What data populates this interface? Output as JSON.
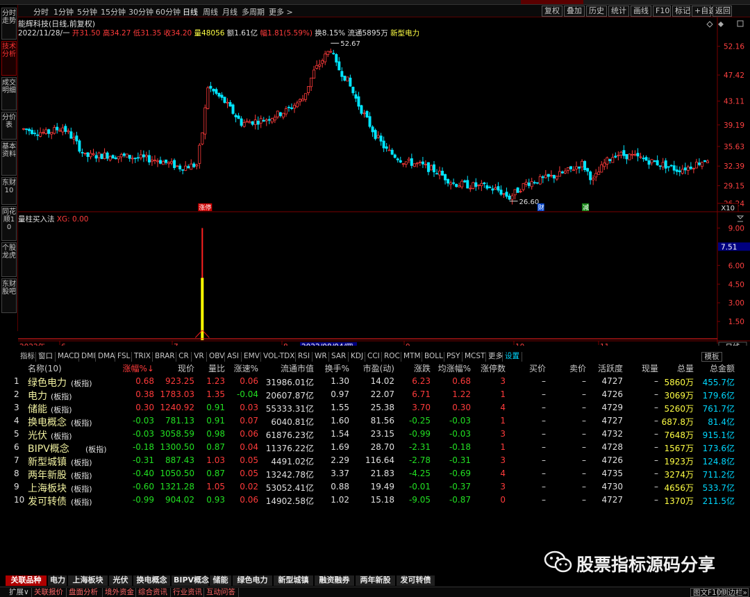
{
  "left_tabs": [
    "分时走势",
    "技术分析",
    "成交明细",
    "分价表",
    "基本资料",
    "东财10",
    "同花顺10",
    "个股龙虎",
    "东财股吧"
  ],
  "periods": [
    "分时",
    "1分钟",
    "5分钟",
    "15分钟",
    "30分钟",
    "60分钟",
    "日线",
    "周线",
    "月线",
    "多周期",
    "更多 >"
  ],
  "active_period": "日线",
  "right_buttons": [
    "复权",
    "叠加",
    "历史",
    "统计",
    "画线",
    "F10",
    "标记",
    "+自选",
    "返回"
  ],
  "stock": {
    "name_line": "能辉科技(日线,前复权)",
    "info_date": "2022/11/28/一",
    "open": "开31.50",
    "high": "高34.27",
    "low": "低31.35",
    "close": "收34.20",
    "volume": "量48056",
    "amount": "额1.61亿",
    "change": "幅1.81(5.59%)",
    "turnover": "换8.15%",
    "float": "流通5895万",
    "concept": "新型电力"
  },
  "price_axis": [
    "52.16",
    "47.42",
    "43.11",
    "39.19",
    "35.63",
    "32.39",
    "29.15",
    "26.24"
  ],
  "price_axis_unit": "X10",
  "high_label": "52.67",
  "low_label": "26.60",
  "event_markers": [
    {
      "label": "涨停",
      "color": "#cc0000"
    },
    {
      "label": "财",
      "color": "#0044cc"
    },
    {
      "label": "减",
      "color": "#1a8a1a"
    }
  ],
  "sub_indicator": {
    "name": "量柱买入法",
    "value": "XG: 0.00"
  },
  "sub_axis": [
    "9.00",
    "7.51",
    "6.00",
    "4.50",
    "3.00",
    "1.50"
  ],
  "time_axis": {
    "year": "2022年",
    "months": [
      "6",
      "7",
      "8",
      "9",
      "10",
      "11"
    ],
    "cursor": "2022/08/04/四",
    "period_label": "日线"
  },
  "indicator_tabs": [
    "指标",
    "窗口",
    "MACD",
    "DMI",
    "DMA",
    "FSL",
    "TRIX",
    "BRAR",
    "CR",
    "VR",
    "OBV",
    "ASI",
    "EMV",
    "VOL-TDX",
    "RSI",
    "WR",
    "SAR",
    "KDJ",
    "CCI",
    "ROC",
    "MTM",
    "BOLL",
    "PSY",
    "MCST",
    "更多",
    "设置",
    "模板"
  ],
  "table": {
    "headers": [
      "名称(10)",
      "涨幅%↓",
      "现价",
      "量比",
      "涨速%",
      "流通市值",
      "换手%",
      "市盈(动)",
      "涨跌",
      "均涨幅%",
      "涨停数",
      "买价",
      "卖价",
      "活跃度",
      "现量",
      "总量",
      "总金额"
    ],
    "rows": [
      {
        "n": "1",
        "name": "绿色电力",
        "tag": "(板指)",
        "chg": "0.68",
        "price": "923.25",
        "vr": "1.23",
        "spd": "0.06",
        "mv": "31986.01亿",
        "to": "1.30",
        "pe": "14.02",
        "ud": "6.23",
        "avg": "0.68",
        "lim": "3",
        "bid": "–",
        "ask": "–",
        "act": "4727",
        "cur": "–",
        "vol": "5860万",
        "amt": "455.7亿"
      },
      {
        "n": "2",
        "name": "电力",
        "tag": "(板指)",
        "chg": "0.38",
        "price": "1783.03",
        "vr": "1.35",
        "spd": "-0.04",
        "mv": "20607.87亿",
        "to": "0.97",
        "pe": "22.07",
        "ud": "6.71",
        "avg": "1.22",
        "lim": "1",
        "bid": "–",
        "ask": "–",
        "act": "4726",
        "cur": "–",
        "vol": "3069万",
        "amt": "179.6亿"
      },
      {
        "n": "3",
        "name": "储能",
        "tag": "(板指)",
        "chg": "0.30",
        "price": "1240.92",
        "vr": "0.91",
        "spd": "0.03",
        "mv": "55333.31亿",
        "to": "1.55",
        "pe": "25.38",
        "ud": "3.70",
        "avg": "0.30",
        "lim": "4",
        "bid": "–",
        "ask": "–",
        "act": "4729",
        "cur": "–",
        "vol": "5260万",
        "amt": "761.7亿"
      },
      {
        "n": "4",
        "name": "换电概念",
        "tag": "(板指)",
        "chg": "-0.03",
        "price": "781.13",
        "vr": "0.91",
        "spd": "0.07",
        "mv": "6040.81亿",
        "to": "1.60",
        "pe": "81.56",
        "ud": "-0.25",
        "avg": "-0.03",
        "lim": "1",
        "bid": "–",
        "ask": "–",
        "act": "4727",
        "cur": "–",
        "vol": "687.8万",
        "amt": "81.4亿"
      },
      {
        "n": "5",
        "name": "光伏",
        "tag": "(板指)",
        "chg": "-0.03",
        "price": "3058.59",
        "vr": "0.98",
        "spd": "0.06",
        "mv": "61876.23亿",
        "to": "1.54",
        "pe": "23.15",
        "ud": "-0.99",
        "avg": "-0.03",
        "lim": "3",
        "bid": "–",
        "ask": "–",
        "act": "4732",
        "cur": "–",
        "vol": "7648万",
        "amt": "915.1亿"
      },
      {
        "n": "6",
        "name": "BIPV概念",
        "tag": "(板指)",
        "chg": "-0.18",
        "price": "1300.50",
        "vr": "0.87",
        "spd": "0.04",
        "mv": "11376.22亿",
        "to": "1.69",
        "pe": "28.70",
        "ud": "-2.31",
        "avg": "-0.18",
        "lim": "1",
        "bid": "–",
        "ask": "–",
        "act": "4728",
        "cur": "–",
        "vol": "1567万",
        "amt": "173.6亿"
      },
      {
        "n": "7",
        "name": "新型城镇",
        "tag": "(板指)",
        "chg": "-0.31",
        "price": "887.43",
        "vr": "1.03",
        "spd": "0.05",
        "mv": "4491.02亿",
        "to": "2.29",
        "pe": "116.64",
        "ud": "-2.78",
        "avg": "-0.31",
        "lim": "3",
        "bid": "–",
        "ask": "–",
        "act": "4726",
        "cur": "–",
        "vol": "1923万",
        "amt": "124.8亿"
      },
      {
        "n": "8",
        "name": "两年新股",
        "tag": "(板指)",
        "chg": "-0.40",
        "price": "1050.50",
        "vr": "0.87",
        "spd": "0.05",
        "mv": "13242.78亿",
        "to": "3.37",
        "pe": "21.83",
        "ud": "-4.25",
        "avg": "-0.69",
        "lim": "4",
        "bid": "–",
        "ask": "–",
        "act": "4735",
        "cur": "–",
        "vol": "3274万",
        "amt": "711.2亿"
      },
      {
        "n": "9",
        "name": "上海板块",
        "tag": "(板指)",
        "chg": "-0.60",
        "price": "1321.28",
        "vr": "1.05",
        "spd": "0.02",
        "mv": "53052.41亿",
        "to": "0.88",
        "pe": "19.49",
        "ud": "-0.01",
        "avg": "-0.37",
        "lim": "3",
        "bid": "–",
        "ask": "–",
        "act": "4730",
        "cur": "–",
        "vol": "4656万",
        "amt": "533.7亿"
      },
      {
        "n": "10",
        "name": "发可转债",
        "tag": "(板指)",
        "chg": "-0.99",
        "price": "904.02",
        "vr": "0.93",
        "spd": "0.06",
        "mv": "14902.58亿",
        "to": "1.02",
        "pe": "15.18",
        "ud": "-9.05",
        "avg": "-0.87",
        "lim": "0",
        "bid": "–",
        "ask": "–",
        "act": "4727",
        "cur": "–",
        "vol": "1370万",
        "amt": "211.5亿"
      }
    ]
  },
  "bottom_tabs": [
    "关联品种",
    "电力",
    "上海板块",
    "光伏",
    "换电概念",
    "BIPV概念",
    "储能",
    "绿色电力",
    "新型城镇",
    "融资融券",
    "两年新股",
    "发可转债"
  ],
  "status_items": [
    "扩展∨",
    "关联报价",
    "盘面分析",
    "境外资金",
    "综合资讯",
    "行业资讯",
    "互动问答"
  ],
  "status_right": [
    "图文F10",
    "侧边栏»"
  ],
  "watermark": "股票指标源码分享",
  "colors": {
    "up": "#ff3b3b",
    "down": "#00e5ff",
    "ma": "#ffffff",
    "volume_bar": "#ffff00",
    "accent_red": "#b00000"
  }
}
